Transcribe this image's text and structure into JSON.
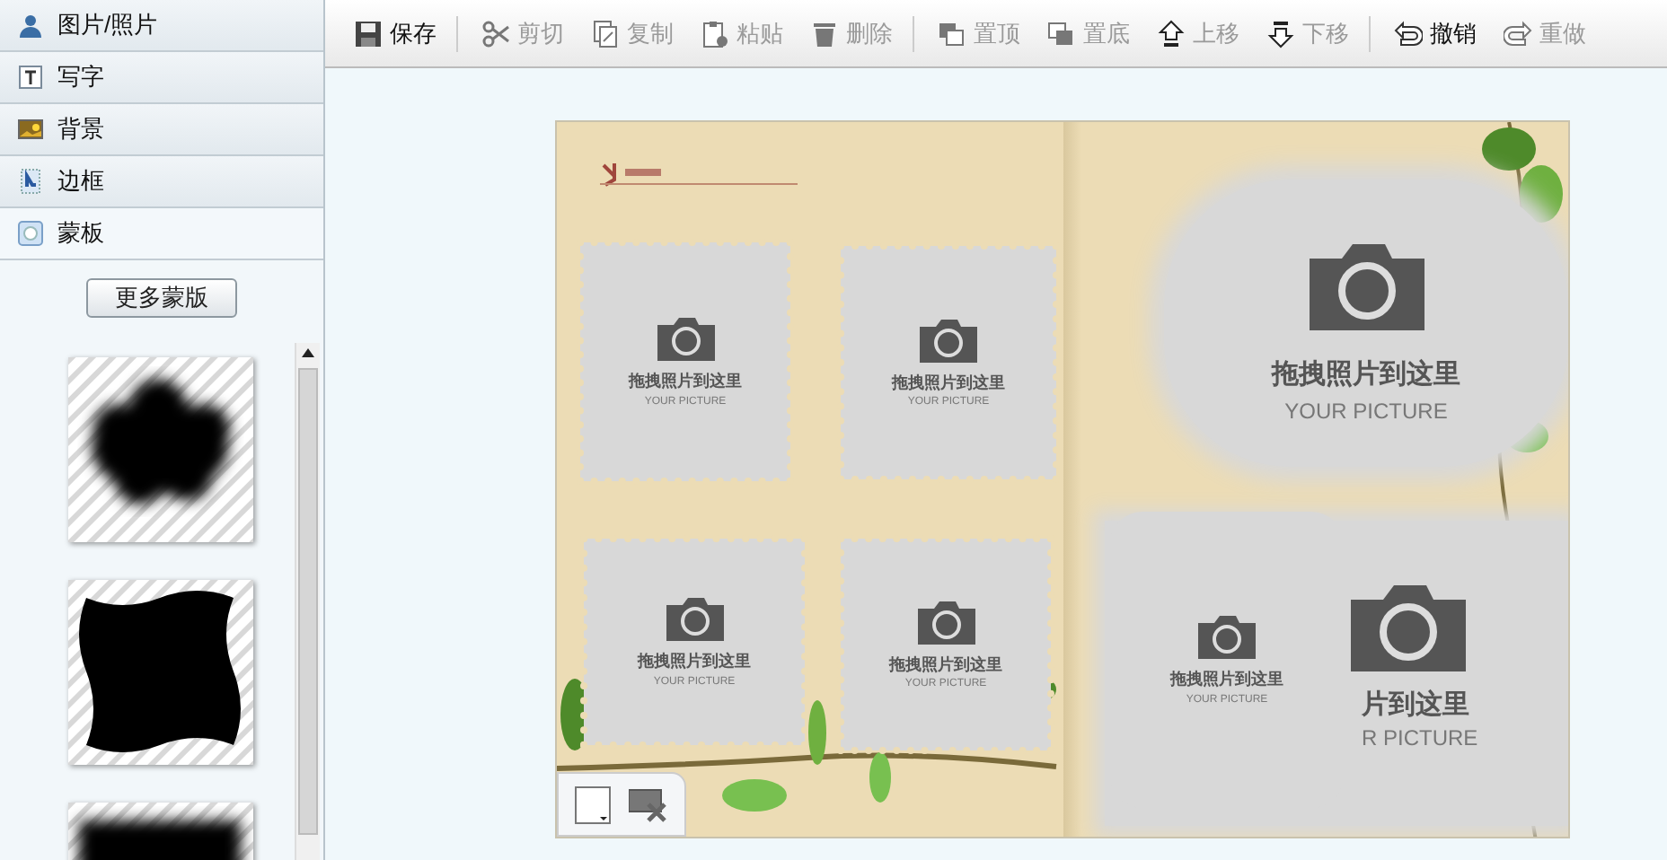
{
  "sidebar": {
    "tabs": [
      {
        "label": "图片/照片",
        "kind": "person",
        "selected": false
      },
      {
        "label": "写字",
        "kind": "text",
        "selected": false
      },
      {
        "label": "背景",
        "kind": "landscape",
        "selected": false
      },
      {
        "label": "边框",
        "kind": "frame",
        "selected": false
      },
      {
        "label": "蒙板",
        "kind": "mask",
        "selected": true
      }
    ],
    "more_button": "更多蒙版",
    "masks": [
      {
        "kind": "cloud"
      },
      {
        "kind": "wavy"
      },
      {
        "kind": "blur"
      }
    ]
  },
  "toolbar": [
    {
      "label": "保存",
      "kind": "save",
      "disabled": false,
      "separator_after": true
    },
    {
      "label": "剪切",
      "kind": "scissors",
      "disabled": true,
      "separator_after": false
    },
    {
      "label": "复制",
      "kind": "copy",
      "disabled": true,
      "separator_after": false
    },
    {
      "label": "粘贴",
      "kind": "paste",
      "disabled": true,
      "separator_after": false
    },
    {
      "label": "删除",
      "kind": "trash",
      "disabled": true,
      "separator_after": true
    },
    {
      "label": "置顶",
      "kind": "front",
      "disabled": true,
      "separator_after": false
    },
    {
      "label": "置底",
      "kind": "back",
      "disabled": true,
      "separator_after": false
    },
    {
      "label": "上移",
      "kind": "up",
      "disabled": true,
      "separator_after": false
    },
    {
      "label": "下移",
      "kind": "down",
      "disabled": true,
      "separator_after": true
    },
    {
      "label": "撤销",
      "kind": "undo",
      "disabled": false,
      "separator_after": false
    },
    {
      "label": "重做",
      "kind": "redo",
      "disabled": true,
      "separator_after": false
    }
  ],
  "album": {
    "slots": [
      {
        "kind": "stamp",
        "label": "拖拽照片到这里",
        "sublabel": "YOUR PICTURE"
      },
      {
        "kind": "stamp",
        "label": "拖拽照片到这里",
        "sublabel": "YOUR PICTURE"
      },
      {
        "kind": "stamp",
        "label": "拖拽照片到这里",
        "sublabel": "YOUR PICTURE"
      },
      {
        "kind": "stamp",
        "label": "拖拽照片到这里",
        "sublabel": "YOUR PICTURE"
      },
      {
        "kind": "cloud",
        "label": "拖拽照片到这里",
        "sublabel": "YOUR PICTURE"
      },
      {
        "kind": "covered",
        "label": "片到这里",
        "sublabel": "R PICTURE"
      },
      {
        "kind": "wavy",
        "label": "拖拽照片到这里",
        "sublabel": "YOUR PICTURE"
      }
    ]
  }
}
